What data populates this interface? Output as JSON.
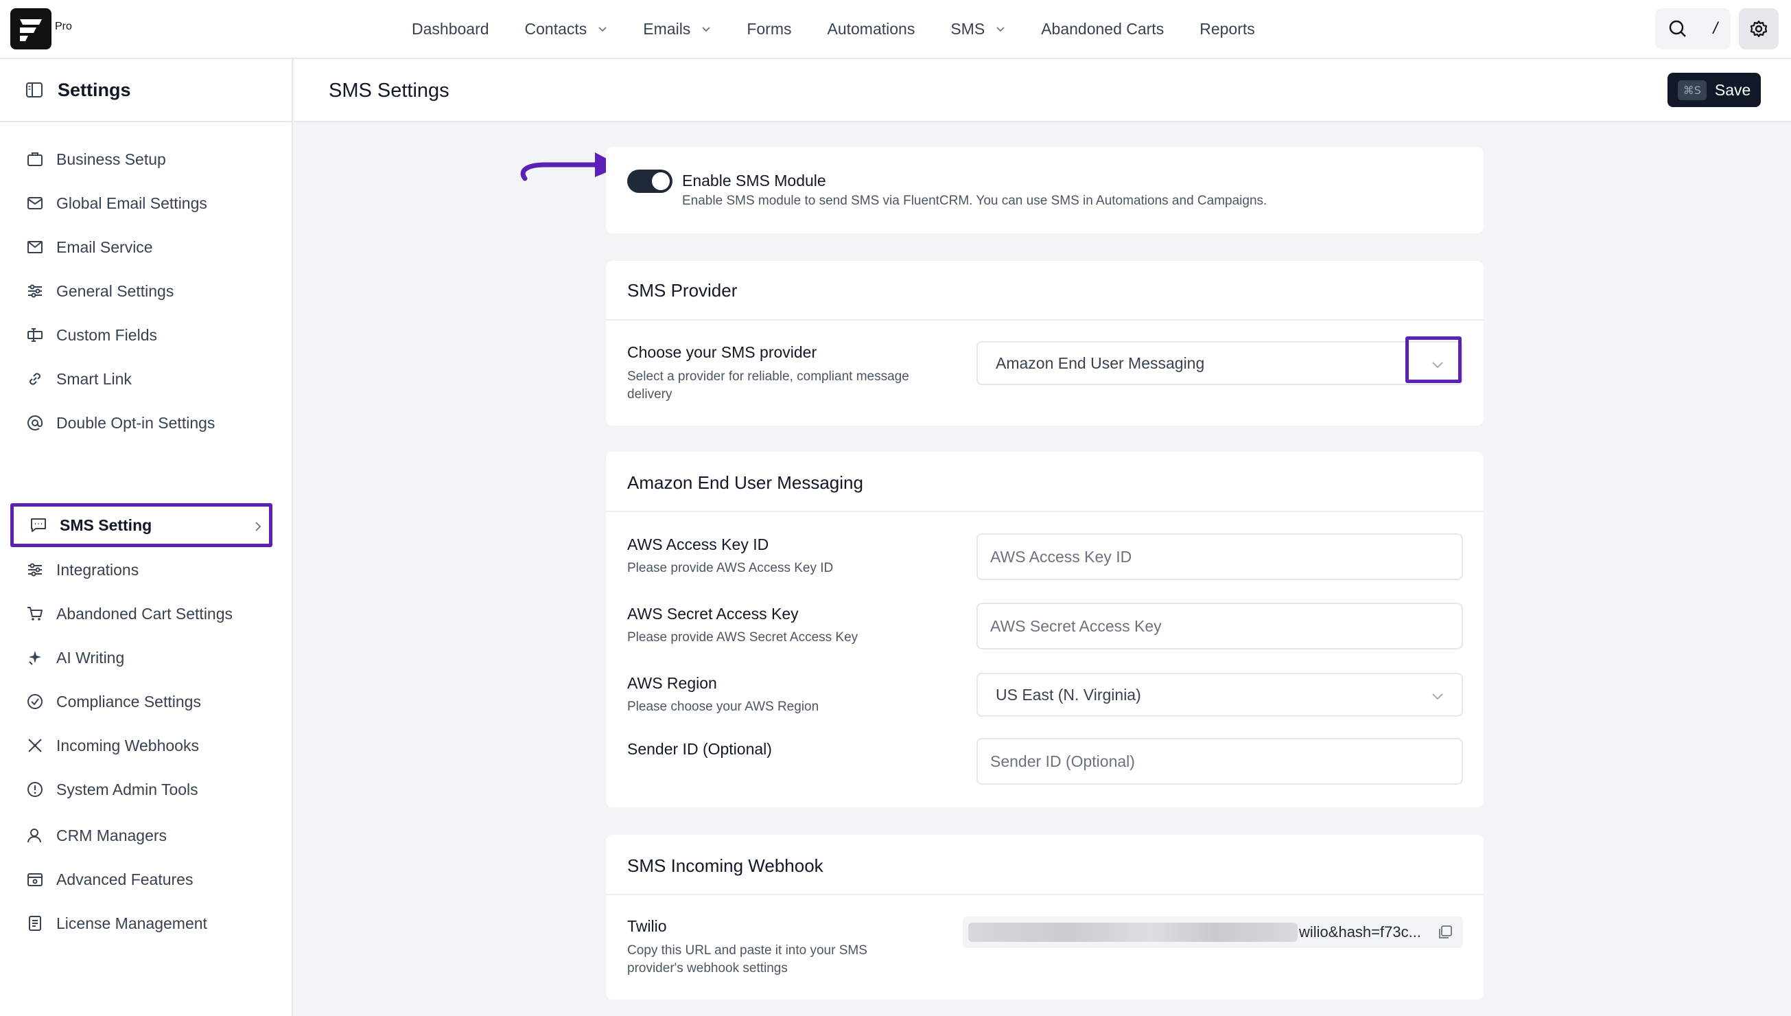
{
  "app": {
    "brand_badge": "Pro"
  },
  "nav": {
    "items": [
      {
        "label": "Dashboard",
        "dropdown": false
      },
      {
        "label": "Contacts",
        "dropdown": true
      },
      {
        "label": "Emails",
        "dropdown": true
      },
      {
        "label": "Forms",
        "dropdown": false
      },
      {
        "label": "Automations",
        "dropdown": false
      },
      {
        "label": "SMS",
        "dropdown": true
      },
      {
        "label": "Abandoned Carts",
        "dropdown": false
      },
      {
        "label": "Reports",
        "dropdown": false
      }
    ],
    "search_shortcut": "/"
  },
  "sidebar": {
    "title": "Settings",
    "items": [
      {
        "label": "Business Setup",
        "icon": "briefcase-icon"
      },
      {
        "label": "Global Email Settings",
        "icon": "email-settings-icon"
      },
      {
        "label": "Email Service",
        "icon": "envelope-icon"
      },
      {
        "label": "General Settings",
        "icon": "sliders-icon"
      },
      {
        "label": "Custom Fields",
        "icon": "custom-fields-icon"
      },
      {
        "label": "Smart Link",
        "icon": "link-icon"
      },
      {
        "label": "Double Opt-in Settings",
        "icon": "at-sign-icon"
      },
      {
        "label": "SMS Setting",
        "icon": "message-icon",
        "active": true
      },
      {
        "label": "Integrations",
        "icon": "sliders-icon"
      },
      {
        "label": "Abandoned Cart Settings",
        "icon": "cart-icon"
      },
      {
        "label": "AI Writing",
        "icon": "sparkle-icon"
      },
      {
        "label": "Compliance Settings",
        "icon": "check-circle-icon"
      },
      {
        "label": "Incoming Webhooks",
        "icon": "webhook-icon"
      },
      {
        "label": "System Admin Tools",
        "icon": "alert-circle-icon"
      },
      {
        "label": "CRM Managers",
        "icon": "user-icon"
      },
      {
        "label": "Advanced Features",
        "icon": "advanced-icon"
      },
      {
        "label": "License Management",
        "icon": "license-icon"
      }
    ]
  },
  "main": {
    "title": "SMS Settings",
    "save": {
      "shortcut": "⌘S",
      "label": "Save"
    },
    "enable": {
      "title": "Enable SMS Module",
      "description": "Enable SMS module to send SMS via FluentCRM. You can use SMS in Automations and Campaigns.",
      "enabled": true
    },
    "provider": {
      "heading": "SMS Provider",
      "label": "Choose your SMS provider",
      "help": "Select a provider for reliable, compliant message delivery",
      "selected": "Amazon End User Messaging"
    },
    "amazon": {
      "heading": "Amazon End User Messaging",
      "access_key": {
        "label": "AWS Access Key ID",
        "help": "Please provide AWS Access Key ID",
        "placeholder": "AWS Access Key ID"
      },
      "secret_key": {
        "label": "AWS Secret Access Key",
        "help": "Please provide AWS Secret Access Key",
        "placeholder": "AWS Secret Access Key"
      },
      "region": {
        "label": "AWS Region",
        "help": "Please choose your AWS Region",
        "selected": "US East (N. Virginia)"
      },
      "sender": {
        "label": "Sender ID (Optional)",
        "placeholder": "Sender ID (Optional)"
      }
    },
    "webhook": {
      "heading": "SMS Incoming Webhook",
      "label": "Twilio",
      "help": "Copy this URL and paste it into your SMS provider's webhook settings",
      "url_visible": "wilio&hash=f73c..."
    }
  },
  "colors": {
    "accent": "#5b21b6",
    "dark": "#111827"
  }
}
